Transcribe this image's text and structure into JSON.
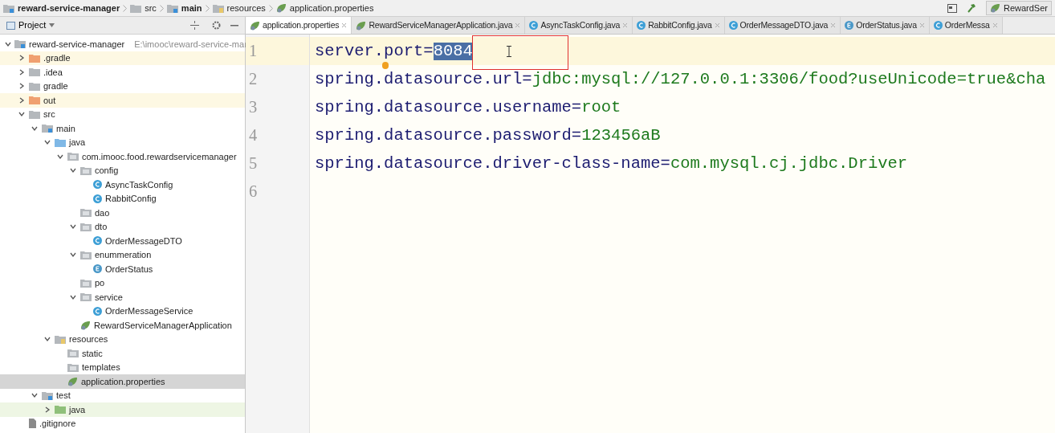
{
  "breadcrumbs": [
    {
      "label": "reward-service-manager",
      "kind": "module",
      "bold": true
    },
    {
      "label": "src",
      "kind": "folder",
      "bold": false
    },
    {
      "label": "main",
      "kind": "module",
      "bold": true
    },
    {
      "label": "resources",
      "kind": "resources",
      "bold": false
    },
    {
      "label": "application.properties",
      "kind": "spring",
      "bold": false
    }
  ],
  "run_config": "RewardSer",
  "project_panel": {
    "title": "Project"
  },
  "tree": [
    {
      "label": "reward-service-manager",
      "path": "E:\\imooc\\reward-service-mar",
      "kind": "module",
      "expanded": true,
      "selected": false,
      "children": [
        {
          "label": ".gradle",
          "kind": "excluded",
          "expanded": false,
          "selected": false
        },
        {
          "label": ".idea",
          "kind": "folder",
          "expanded": false,
          "selected": false
        },
        {
          "label": "gradle",
          "kind": "folder",
          "expanded": false,
          "selected": false
        },
        {
          "label": "out",
          "kind": "excluded",
          "expanded": false,
          "selected": false
        },
        {
          "label": "src",
          "kind": "folder",
          "expanded": true,
          "selected": false,
          "children": [
            {
              "label": "main",
              "kind": "module",
              "expanded": true,
              "selected": false,
              "children": [
                {
                  "label": "java",
                  "kind": "source",
                  "expanded": true,
                  "selected": false,
                  "children": [
                    {
                      "label": "com.imooc.food.rewardservicemanager",
                      "kind": "package",
                      "expanded": true,
                      "selected": false,
                      "children": [
                        {
                          "label": "config",
                          "kind": "package",
                          "expanded": true,
                          "selected": false,
                          "children": [
                            {
                              "label": "AsyncTaskConfig",
                              "kind": "class",
                              "selected": false
                            },
                            {
                              "label": "RabbitConfig",
                              "kind": "class",
                              "selected": false
                            }
                          ]
                        },
                        {
                          "label": "dao",
                          "kind": "package",
                          "selected": false
                        },
                        {
                          "label": "dto",
                          "kind": "package",
                          "expanded": true,
                          "selected": false,
                          "children": [
                            {
                              "label": "OrderMessageDTO",
                              "kind": "class",
                              "selected": false
                            }
                          ]
                        },
                        {
                          "label": "enummeration",
                          "kind": "package",
                          "expanded": true,
                          "selected": false,
                          "children": [
                            {
                              "label": "OrderStatus",
                              "kind": "enum",
                              "selected": false
                            }
                          ]
                        },
                        {
                          "label": "po",
                          "kind": "package",
                          "selected": false
                        },
                        {
                          "label": "service",
                          "kind": "package",
                          "expanded": true,
                          "selected": false,
                          "children": [
                            {
                              "label": "OrderMessageService",
                              "kind": "class",
                              "selected": false
                            }
                          ]
                        },
                        {
                          "label": "RewardServiceManagerApplication",
                          "kind": "spring",
                          "selected": false
                        }
                      ]
                    }
                  ]
                },
                {
                  "label": "resources",
                  "kind": "resources",
                  "expanded": true,
                  "selected": false,
                  "children": [
                    {
                      "label": "static",
                      "kind": "package",
                      "selected": false
                    },
                    {
                      "label": "templates",
                      "kind": "package",
                      "selected": false
                    },
                    {
                      "label": "application.properties",
                      "kind": "spring",
                      "selected": true
                    }
                  ]
                }
              ]
            },
            {
              "label": "test",
              "kind": "module",
              "expanded": true,
              "selected": false,
              "children": [
                {
                  "label": "java",
                  "kind": "test-source",
                  "expanded": false,
                  "selected": false
                }
              ]
            }
          ]
        },
        {
          "label": ".gitignore",
          "kind": "file",
          "selected": false
        }
      ]
    }
  ],
  "tabs": [
    {
      "label": "application.properties",
      "kind": "spring",
      "selected": true
    },
    {
      "label": "RewardServiceManagerApplication.java",
      "kind": "spring",
      "selected": false
    },
    {
      "label": "AsyncTaskConfig.java",
      "kind": "class",
      "selected": false
    },
    {
      "label": "RabbitConfig.java",
      "kind": "class",
      "selected": false
    },
    {
      "label": "OrderMessageDTO.java",
      "kind": "class",
      "selected": false
    },
    {
      "label": "OrderStatus.java",
      "kind": "enum",
      "selected": false
    },
    {
      "label": "OrderMessa",
      "kind": "class",
      "selected": false
    }
  ],
  "editor": {
    "lines": [
      {
        "number": "1",
        "key": "server.port",
        "sep": "=",
        "value": "8084",
        "current": true,
        "value_selected": true
      },
      {
        "number": "2",
        "key": "spring.datasource.url",
        "sep": "=",
        "value": "jdbc:mysql://127.0.0.1:3306/food?useUnicode=true&cha",
        "current": false,
        "value_selected": false
      },
      {
        "number": "3",
        "key": "spring.datasource.username",
        "sep": "=",
        "value": "root",
        "current": false,
        "value_selected": false
      },
      {
        "number": "4",
        "key": "spring.datasource.password",
        "sep": "=",
        "value": "123456aB",
        "current": false,
        "value_selected": false
      },
      {
        "number": "5",
        "key": "spring.datasource.driver-class-name",
        "sep": "=",
        "value": "com.mysql.cj.jdbc.Driver",
        "current": false,
        "value_selected": false
      },
      {
        "number": "6",
        "current": false
      }
    ]
  }
}
